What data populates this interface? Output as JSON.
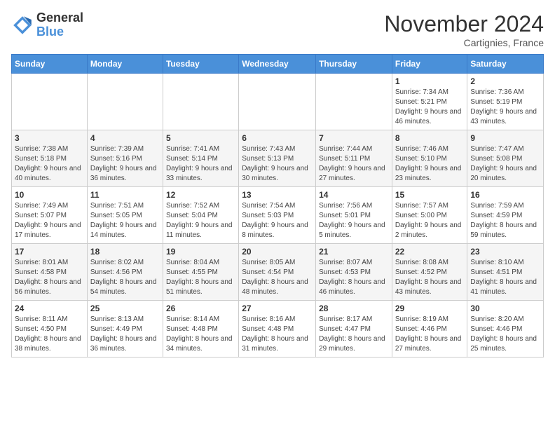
{
  "logo": {
    "general": "General",
    "blue": "Blue"
  },
  "header": {
    "month": "November 2024",
    "location": "Cartignies, France"
  },
  "weekdays": [
    "Sunday",
    "Monday",
    "Tuesday",
    "Wednesday",
    "Thursday",
    "Friday",
    "Saturday"
  ],
  "weeks": [
    [
      {
        "day": "",
        "info": ""
      },
      {
        "day": "",
        "info": ""
      },
      {
        "day": "",
        "info": ""
      },
      {
        "day": "",
        "info": ""
      },
      {
        "day": "",
        "info": ""
      },
      {
        "day": "1",
        "info": "Sunrise: 7:34 AM\nSunset: 5:21 PM\nDaylight: 9 hours and 46 minutes."
      },
      {
        "day": "2",
        "info": "Sunrise: 7:36 AM\nSunset: 5:19 PM\nDaylight: 9 hours and 43 minutes."
      }
    ],
    [
      {
        "day": "3",
        "info": "Sunrise: 7:38 AM\nSunset: 5:18 PM\nDaylight: 9 hours and 40 minutes."
      },
      {
        "day": "4",
        "info": "Sunrise: 7:39 AM\nSunset: 5:16 PM\nDaylight: 9 hours and 36 minutes."
      },
      {
        "day": "5",
        "info": "Sunrise: 7:41 AM\nSunset: 5:14 PM\nDaylight: 9 hours and 33 minutes."
      },
      {
        "day": "6",
        "info": "Sunrise: 7:43 AM\nSunset: 5:13 PM\nDaylight: 9 hours and 30 minutes."
      },
      {
        "day": "7",
        "info": "Sunrise: 7:44 AM\nSunset: 5:11 PM\nDaylight: 9 hours and 27 minutes."
      },
      {
        "day": "8",
        "info": "Sunrise: 7:46 AM\nSunset: 5:10 PM\nDaylight: 9 hours and 23 minutes."
      },
      {
        "day": "9",
        "info": "Sunrise: 7:47 AM\nSunset: 5:08 PM\nDaylight: 9 hours and 20 minutes."
      }
    ],
    [
      {
        "day": "10",
        "info": "Sunrise: 7:49 AM\nSunset: 5:07 PM\nDaylight: 9 hours and 17 minutes."
      },
      {
        "day": "11",
        "info": "Sunrise: 7:51 AM\nSunset: 5:05 PM\nDaylight: 9 hours and 14 minutes."
      },
      {
        "day": "12",
        "info": "Sunrise: 7:52 AM\nSunset: 5:04 PM\nDaylight: 9 hours and 11 minutes."
      },
      {
        "day": "13",
        "info": "Sunrise: 7:54 AM\nSunset: 5:03 PM\nDaylight: 9 hours and 8 minutes."
      },
      {
        "day": "14",
        "info": "Sunrise: 7:56 AM\nSunset: 5:01 PM\nDaylight: 9 hours and 5 minutes."
      },
      {
        "day": "15",
        "info": "Sunrise: 7:57 AM\nSunset: 5:00 PM\nDaylight: 9 hours and 2 minutes."
      },
      {
        "day": "16",
        "info": "Sunrise: 7:59 AM\nSunset: 4:59 PM\nDaylight: 8 hours and 59 minutes."
      }
    ],
    [
      {
        "day": "17",
        "info": "Sunrise: 8:01 AM\nSunset: 4:58 PM\nDaylight: 8 hours and 56 minutes."
      },
      {
        "day": "18",
        "info": "Sunrise: 8:02 AM\nSunset: 4:56 PM\nDaylight: 8 hours and 54 minutes."
      },
      {
        "day": "19",
        "info": "Sunrise: 8:04 AM\nSunset: 4:55 PM\nDaylight: 8 hours and 51 minutes."
      },
      {
        "day": "20",
        "info": "Sunrise: 8:05 AM\nSunset: 4:54 PM\nDaylight: 8 hours and 48 minutes."
      },
      {
        "day": "21",
        "info": "Sunrise: 8:07 AM\nSunset: 4:53 PM\nDaylight: 8 hours and 46 minutes."
      },
      {
        "day": "22",
        "info": "Sunrise: 8:08 AM\nSunset: 4:52 PM\nDaylight: 8 hours and 43 minutes."
      },
      {
        "day": "23",
        "info": "Sunrise: 8:10 AM\nSunset: 4:51 PM\nDaylight: 8 hours and 41 minutes."
      }
    ],
    [
      {
        "day": "24",
        "info": "Sunrise: 8:11 AM\nSunset: 4:50 PM\nDaylight: 8 hours and 38 minutes."
      },
      {
        "day": "25",
        "info": "Sunrise: 8:13 AM\nSunset: 4:49 PM\nDaylight: 8 hours and 36 minutes."
      },
      {
        "day": "26",
        "info": "Sunrise: 8:14 AM\nSunset: 4:48 PM\nDaylight: 8 hours and 34 minutes."
      },
      {
        "day": "27",
        "info": "Sunrise: 8:16 AM\nSunset: 4:48 PM\nDaylight: 8 hours and 31 minutes."
      },
      {
        "day": "28",
        "info": "Sunrise: 8:17 AM\nSunset: 4:47 PM\nDaylight: 8 hours and 29 minutes."
      },
      {
        "day": "29",
        "info": "Sunrise: 8:19 AM\nSunset: 4:46 PM\nDaylight: 8 hours and 27 minutes."
      },
      {
        "day": "30",
        "info": "Sunrise: 8:20 AM\nSunset: 4:46 PM\nDaylight: 8 hours and 25 minutes."
      }
    ]
  ]
}
